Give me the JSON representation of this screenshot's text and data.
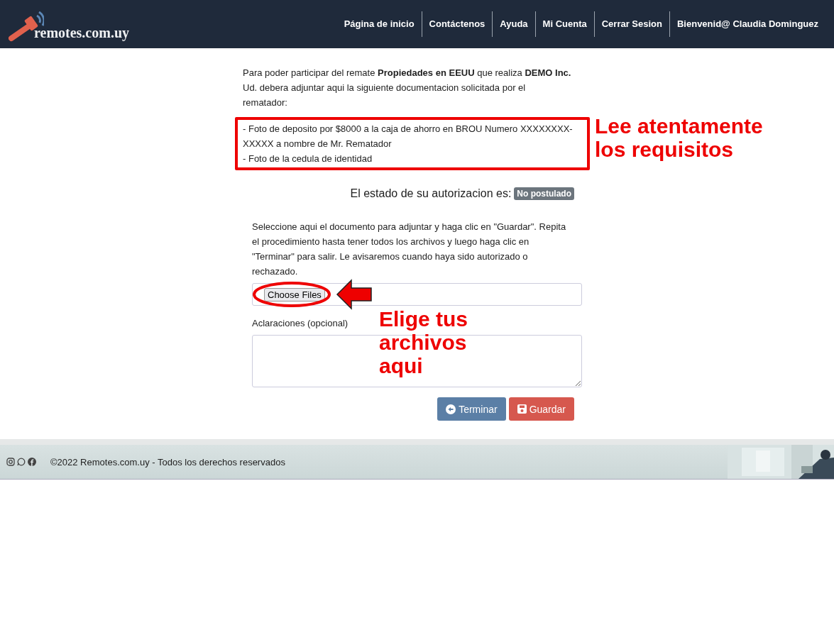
{
  "header": {
    "logo_text": "remotes.com.uy",
    "nav": [
      {
        "label": "Página de inicio"
      },
      {
        "label": "Contáctenos"
      },
      {
        "label": "Ayuda"
      },
      {
        "label": "Mi Cuenta"
      },
      {
        "label": "Cerrar Sesion"
      },
      {
        "label": "Bienvenid@ Claudia Dominguez"
      }
    ]
  },
  "intro": "Para poder participar del remate **Propiedades en EEUU** que realiza **DEMO Inc.** Ud. debera adjuntar aqui la siguiente documentacion solicitada por el rematador:",
  "requirements": [
    "- Foto de deposito por $8000 a la caja de ahorro en BROU Numero XXXXXXXX-XXXXX a nombre de Mr. Rematador",
    "- Foto de la cedula de identidad"
  ],
  "status": {
    "label": "El estado de su autorizacion es:",
    "badge": "No postulado"
  },
  "instructions": "Seleccione aqui el documento para adjuntar y haga clic en \"Guardar\". Repita el procedimiento hasta tener todos los archivos y luego haga clic en \"Terminar\" para salir. Le avisaremos cuando haya sido autorizado o rechazado.",
  "file_input": {
    "button": "Choose Files"
  },
  "notes": {
    "label": "Aclaraciones (opcional)"
  },
  "buttons": [
    {
      "label": "Terminar",
      "kind": "back"
    },
    {
      "label": "Guardar",
      "kind": "save"
    }
  ],
  "annotations": [
    {
      "text": "Lee atentamente los requisitos"
    },
    {
      "text": "Elige tus archivos aqui"
    }
  ],
  "footer": {
    "text": "©2022 Remotes.com.uy - Todos los derechos reservados"
  }
}
